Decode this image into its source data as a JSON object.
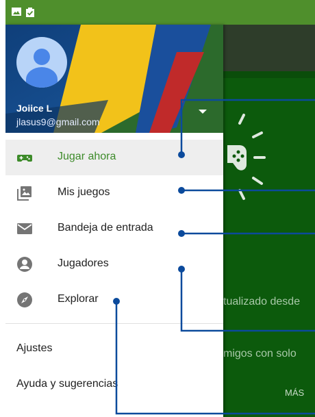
{
  "theme": {
    "accent": "#3d8b2a",
    "callout": "#0b4a9c",
    "status_bar": "#4f8f2c",
    "scrim_green": "#0c5a0c"
  },
  "status_bar": {
    "icons": [
      "image-icon",
      "clipboard-check-icon"
    ]
  },
  "account": {
    "name": "Joiice L",
    "email": "jlasus9@gmail.com"
  },
  "nav": {
    "items": [
      {
        "label": "Jugar ahora",
        "icon": "gamepad-icon",
        "active": true
      },
      {
        "label": "Mis juegos",
        "icon": "library-icon",
        "active": false
      },
      {
        "label": "Bandeja de entrada",
        "icon": "mail-icon",
        "active": false
      },
      {
        "label": "Jugadores",
        "icon": "person-icon",
        "active": false
      },
      {
        "label": "Explorar",
        "icon": "compass-icon",
        "active": false
      }
    ]
  },
  "secondary": {
    "settings": "Ajustes",
    "help": "Ayuda y sugerencias"
  },
  "background": {
    "line1": "tualizado desde",
    "line2": "migos con solo",
    "more": "MÁS"
  }
}
